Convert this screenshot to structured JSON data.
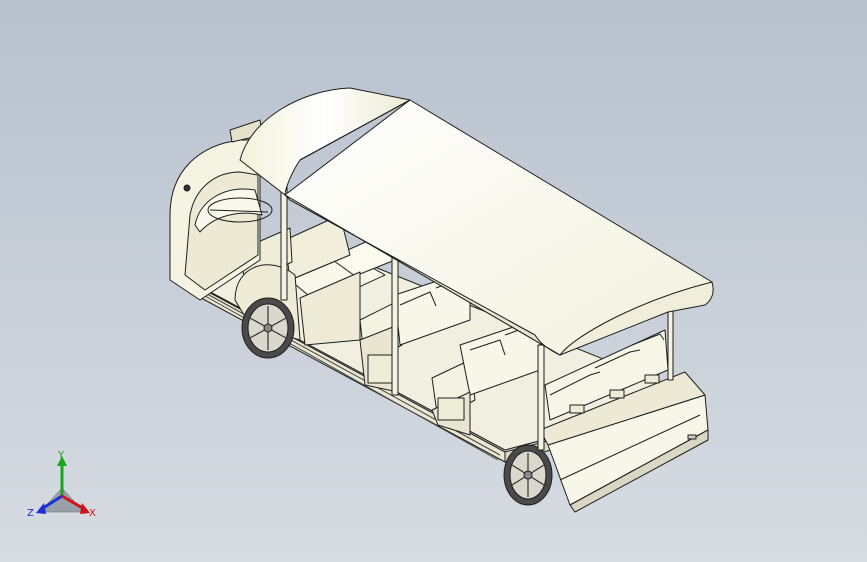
{
  "viewport": {
    "colors": {
      "bg_top": "#B7C1CE",
      "bg_bottom": "#D7DCE2",
      "body_fill": "#FAF9EC",
      "roof_fill": "#FBFBF2",
      "shade_fill": "#E6E4CF",
      "outline": "#1E1E1E",
      "wheel_fill": "#D9D8CC",
      "tire_fill": "#4A4A4A"
    }
  },
  "triad": {
    "x_label": "X",
    "y_label": "Y",
    "z_label": "Z",
    "x_color": "#D0121A",
    "y_color": "#1CA31C",
    "z_color": "#1A2FD2"
  }
}
